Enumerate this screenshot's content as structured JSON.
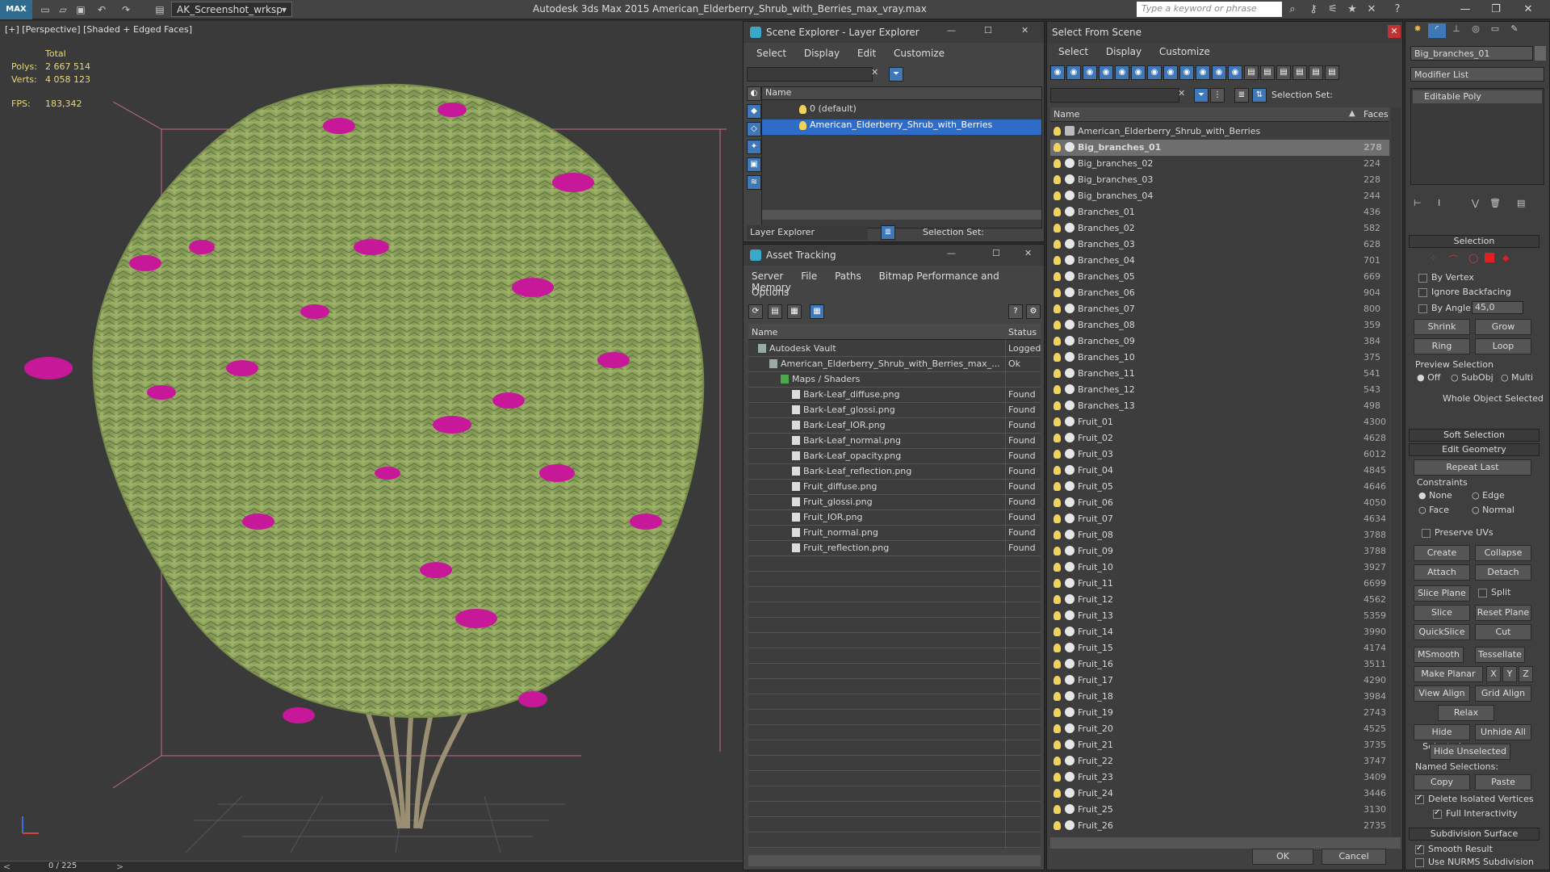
{
  "app": {
    "title": "Autodesk 3ds Max  2015     American_Elderberry_Shrub_with_Berries_max_vray.max",
    "logo": "MAX",
    "workspace": "AK_Screenshot_wrksp",
    "search_placeholder": "Type a keyword or phrase"
  },
  "viewport": {
    "label": "[+] [Perspective] [Shaded + Edged Faces]",
    "stats": {
      "total_label": "Total",
      "polys_label": "Polys:",
      "polys_value": "2 667 514",
      "verts_label": "Verts:",
      "verts_value": "4 058 123",
      "fps_label": "FPS:",
      "fps_value": "183,342"
    },
    "frame": "0 / 225",
    "colors": {
      "foliage": "#8aa05a",
      "berries": "#c8189a",
      "bg": "#3a3a3a"
    }
  },
  "scene_explorer": {
    "title": "Scene Explorer - Layer Explorer",
    "menu": [
      "Select",
      "Display",
      "Edit",
      "Customize"
    ],
    "column_name": "Name",
    "layers": [
      "0 (default)",
      "American_Elderberry_Shrub_with_Berries"
    ],
    "footer_label": "Layer Explorer",
    "selection_set_label": "Selection Set:"
  },
  "asset_tracking": {
    "title": "Asset Tracking",
    "menu": [
      "Server",
      "File",
      "Paths",
      "Bitmap Performance and Memory"
    ],
    "menu2": "Options",
    "col_name": "Name",
    "col_status": "Status",
    "rows": [
      {
        "name": "Autodesk Vault",
        "status": "Logged",
        "indent": 0
      },
      {
        "name": "American_Elderberry_Shrub_with_Berries_max_...",
        "status": "Ok",
        "indent": 1
      },
      {
        "name": "Maps / Shaders",
        "status": "",
        "indent": 2
      },
      {
        "name": "Bark-Leaf_diffuse.png",
        "status": "Found",
        "indent": 3
      },
      {
        "name": "Bark-Leaf_glossi.png",
        "status": "Found",
        "indent": 3
      },
      {
        "name": "Bark-Leaf_IOR.png",
        "status": "Found",
        "indent": 3
      },
      {
        "name": "Bark-Leaf_normal.png",
        "status": "Found",
        "indent": 3
      },
      {
        "name": "Bark-Leaf_opacity.png",
        "status": "Found",
        "indent": 3
      },
      {
        "name": "Bark-Leaf_reflection.png",
        "status": "Found",
        "indent": 3
      },
      {
        "name": "Fruit_diffuse.png",
        "status": "Found",
        "indent": 3
      },
      {
        "name": "Fruit_glossi.png",
        "status": "Found",
        "indent": 3
      },
      {
        "name": "Fruit_IOR.png",
        "status": "Found",
        "indent": 3
      },
      {
        "name": "Fruit_normal.png",
        "status": "Found",
        "indent": 3
      },
      {
        "name": "Fruit_reflection.png",
        "status": "Found",
        "indent": 3
      }
    ]
  },
  "select_from_scene": {
    "title": "Select From Scene",
    "menu": [
      "Select",
      "Display",
      "Customize"
    ],
    "selection_set_label": "Selection Set:",
    "col_name": "Name",
    "col_faces": "Faces",
    "rows": [
      {
        "name": "American_Elderberry_Shrub_with_Berries",
        "faces": ""
      },
      {
        "name": "Big_branches_01",
        "faces": "278"
      },
      {
        "name": "Big_branches_02",
        "faces": "224"
      },
      {
        "name": "Big_branches_03",
        "faces": "228"
      },
      {
        "name": "Big_branches_04",
        "faces": "244"
      },
      {
        "name": "Branches_01",
        "faces": "436"
      },
      {
        "name": "Branches_02",
        "faces": "582"
      },
      {
        "name": "Branches_03",
        "faces": "628"
      },
      {
        "name": "Branches_04",
        "faces": "701"
      },
      {
        "name": "Branches_05",
        "faces": "669"
      },
      {
        "name": "Branches_06",
        "faces": "904"
      },
      {
        "name": "Branches_07",
        "faces": "800"
      },
      {
        "name": "Branches_08",
        "faces": "359"
      },
      {
        "name": "Branches_09",
        "faces": "384"
      },
      {
        "name": "Branches_10",
        "faces": "375"
      },
      {
        "name": "Branches_11",
        "faces": "541"
      },
      {
        "name": "Branches_12",
        "faces": "543"
      },
      {
        "name": "Branches_13",
        "faces": "498"
      },
      {
        "name": "Fruit_01",
        "faces": "4300"
      },
      {
        "name": "Fruit_02",
        "faces": "4628"
      },
      {
        "name": "Fruit_03",
        "faces": "6012"
      },
      {
        "name": "Fruit_04",
        "faces": "4845"
      },
      {
        "name": "Fruit_05",
        "faces": "4646"
      },
      {
        "name": "Fruit_06",
        "faces": "4050"
      },
      {
        "name": "Fruit_07",
        "faces": "4634"
      },
      {
        "name": "Fruit_08",
        "faces": "3788"
      },
      {
        "name": "Fruit_09",
        "faces": "3788"
      },
      {
        "name": "Fruit_10",
        "faces": "3927"
      },
      {
        "name": "Fruit_11",
        "faces": "6699"
      },
      {
        "name": "Fruit_12",
        "faces": "4562"
      },
      {
        "name": "Fruit_13",
        "faces": "5359"
      },
      {
        "name": "Fruit_14",
        "faces": "3990"
      },
      {
        "name": "Fruit_15",
        "faces": "4174"
      },
      {
        "name": "Fruit_16",
        "faces": "3511"
      },
      {
        "name": "Fruit_17",
        "faces": "4290"
      },
      {
        "name": "Fruit_18",
        "faces": "3984"
      },
      {
        "name": "Fruit_19",
        "faces": "2743"
      },
      {
        "name": "Fruit_20",
        "faces": "4525"
      },
      {
        "name": "Fruit_21",
        "faces": "3735"
      },
      {
        "name": "Fruit_22",
        "faces": "3747"
      },
      {
        "name": "Fruit_23",
        "faces": "3409"
      },
      {
        "name": "Fruit_24",
        "faces": "3446"
      },
      {
        "name": "Fruit_25",
        "faces": "3130"
      },
      {
        "name": "Fruit_26",
        "faces": "2735"
      }
    ],
    "ok": "OK",
    "cancel": "Cancel"
  },
  "command_panel": {
    "object_name": "Big_branches_01",
    "modifier_list": "Modifier List",
    "stack_item": "Editable Poly",
    "selection": {
      "title": "Selection",
      "by_vertex": "By Vertex",
      "ignore_backfacing": "Ignore Backfacing",
      "by_angle": "By Angle:",
      "angle_value": "45,0",
      "shrink": "Shrink",
      "grow": "Grow",
      "ring": "Ring",
      "loop": "Loop",
      "preview_label": "Preview Selection",
      "off": "Off",
      "subobj": "SubObj",
      "multi": "Multi",
      "status": "Whole Object Selected"
    },
    "soft_selection": "Soft Selection",
    "edit_geometry": {
      "title": "Edit Geometry",
      "repeat_last": "Repeat Last",
      "constraints": "Constraints",
      "none": "None",
      "edge": "Edge",
      "face": "Face",
      "normal": "Normal",
      "preserve_uvs": "Preserve UVs",
      "create": "Create",
      "collapse": "Collapse",
      "attach": "Attach",
      "detach": "Detach",
      "slice_plane": "Slice Plane",
      "split": "Split",
      "slice": "Slice",
      "reset_plane": "Reset Plane",
      "quickslice": "QuickSlice",
      "cut": "Cut",
      "msmooth": "MSmooth",
      "tessellate": "Tessellate",
      "make_planar": "Make Planar",
      "x": "X",
      "y": "Y",
      "z": "Z",
      "view_align": "View Align",
      "grid_align": "Grid Align",
      "relax": "Relax",
      "hide_selected": "Hide Selected",
      "unhide_all": "Unhide All",
      "hide_unselected": "Hide Unselected",
      "named_selections": "Named Selections:",
      "copy": "Copy",
      "paste": "Paste",
      "delete_isolated": "Delete Isolated Vertices",
      "full_interactivity": "Full Interactivity"
    },
    "subdivision_surface": {
      "title": "Subdivision Surface",
      "smooth_result": "Smooth Result",
      "use_nurms": "Use NURMS Subdivision"
    }
  }
}
